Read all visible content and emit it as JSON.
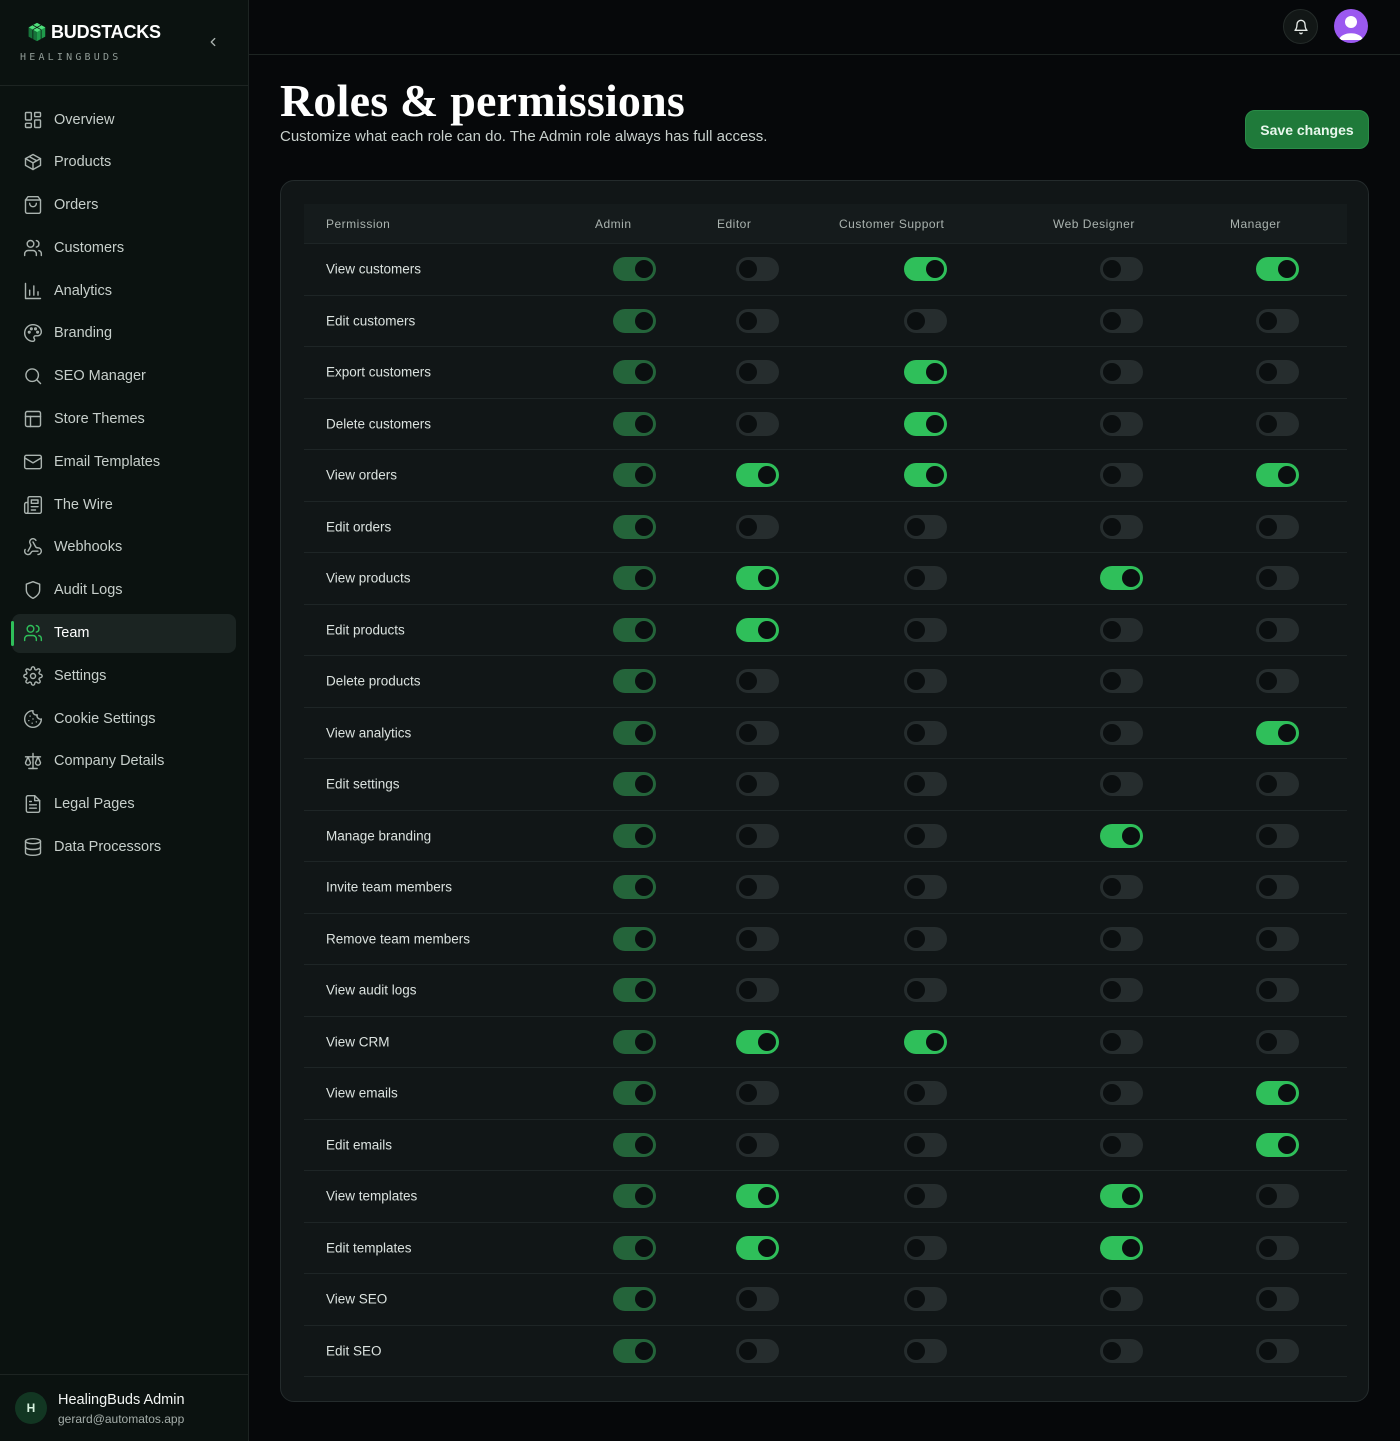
{
  "brand": {
    "name": "BUDSTACKS",
    "subtitle": "HEALINGBUDS"
  },
  "sidebar": {
    "items": [
      {
        "label": "Overview",
        "icon": "layout-grid-icon"
      },
      {
        "label": "Products",
        "icon": "package-icon"
      },
      {
        "label": "Orders",
        "icon": "shopping-bag-icon"
      },
      {
        "label": "Customers",
        "icon": "users-icon"
      },
      {
        "label": "Analytics",
        "icon": "bar-chart-icon"
      },
      {
        "label": "Branding",
        "icon": "palette-icon"
      },
      {
        "label": "SEO Manager",
        "icon": "search-icon"
      },
      {
        "label": "Store Themes",
        "icon": "layout-icon"
      },
      {
        "label": "Email Templates",
        "icon": "mail-icon"
      },
      {
        "label": "The Wire",
        "icon": "newspaper-icon"
      },
      {
        "label": "Webhooks",
        "icon": "webhook-icon"
      },
      {
        "label": "Audit Logs",
        "icon": "shield-icon"
      },
      {
        "label": "Team",
        "icon": "user-icon",
        "active": true
      },
      {
        "label": "Settings",
        "icon": "gear-icon"
      },
      {
        "label": "Cookie Settings",
        "icon": "cookie-icon"
      },
      {
        "label": "Company Details",
        "icon": "scale-icon"
      },
      {
        "label": "Legal Pages",
        "icon": "file-text-icon"
      },
      {
        "label": "Data Processors",
        "icon": "database-icon"
      }
    ]
  },
  "user": {
    "initial": "H",
    "name": "HealingBuds Admin",
    "email": "gerard@automatos.app"
  },
  "page": {
    "title": "Roles & permissions",
    "subtitle": "Customize what each role can do. The Admin role always has full access.",
    "save_label": "Save changes"
  },
  "colors": {
    "accent": "#2fbf5a",
    "accent_dark": "#24643a",
    "toggle_off": "#262d2e",
    "background": "#06080a",
    "card": "#111617",
    "avatar": "#9b59f0"
  },
  "table": {
    "permission_header": "Permission",
    "roles": [
      "Admin",
      "Editor",
      "Customer Support",
      "Web Designer",
      "Manager"
    ],
    "rows": [
      {
        "label": "View customers",
        "values": [
          true,
          false,
          true,
          false,
          true
        ]
      },
      {
        "label": "Edit customers",
        "values": [
          true,
          false,
          false,
          false,
          false
        ]
      },
      {
        "label": "Export customers",
        "values": [
          true,
          false,
          true,
          false,
          false
        ]
      },
      {
        "label": "Delete customers",
        "values": [
          true,
          false,
          true,
          false,
          false
        ]
      },
      {
        "label": "View orders",
        "values": [
          true,
          true,
          true,
          false,
          true
        ]
      },
      {
        "label": "Edit orders",
        "values": [
          true,
          false,
          false,
          false,
          false
        ]
      },
      {
        "label": "View products",
        "values": [
          true,
          true,
          false,
          true,
          false
        ]
      },
      {
        "label": "Edit products",
        "values": [
          true,
          true,
          false,
          false,
          false
        ]
      },
      {
        "label": "Delete products",
        "values": [
          true,
          false,
          false,
          false,
          false
        ]
      },
      {
        "label": "View analytics",
        "values": [
          true,
          false,
          false,
          false,
          true
        ]
      },
      {
        "label": "Edit settings",
        "values": [
          true,
          false,
          false,
          false,
          false
        ]
      },
      {
        "label": "Manage branding",
        "values": [
          true,
          false,
          false,
          true,
          false
        ]
      },
      {
        "label": "Invite team members",
        "values": [
          true,
          false,
          false,
          false,
          false
        ]
      },
      {
        "label": "Remove team members",
        "values": [
          true,
          false,
          false,
          false,
          false
        ]
      },
      {
        "label": "View audit logs",
        "values": [
          true,
          false,
          false,
          false,
          false
        ]
      },
      {
        "label": "View CRM",
        "values": [
          true,
          true,
          true,
          false,
          false
        ]
      },
      {
        "label": "View emails",
        "values": [
          true,
          false,
          false,
          false,
          true
        ]
      },
      {
        "label": "Edit emails",
        "values": [
          true,
          false,
          false,
          false,
          true
        ]
      },
      {
        "label": "View templates",
        "values": [
          true,
          true,
          false,
          true,
          false
        ]
      },
      {
        "label": "Edit templates",
        "values": [
          true,
          true,
          false,
          true,
          false
        ]
      },
      {
        "label": "View SEO",
        "values": [
          true,
          false,
          false,
          false,
          false
        ]
      },
      {
        "label": "Edit SEO",
        "values": [
          true,
          false,
          false,
          false,
          false
        ]
      }
    ]
  }
}
